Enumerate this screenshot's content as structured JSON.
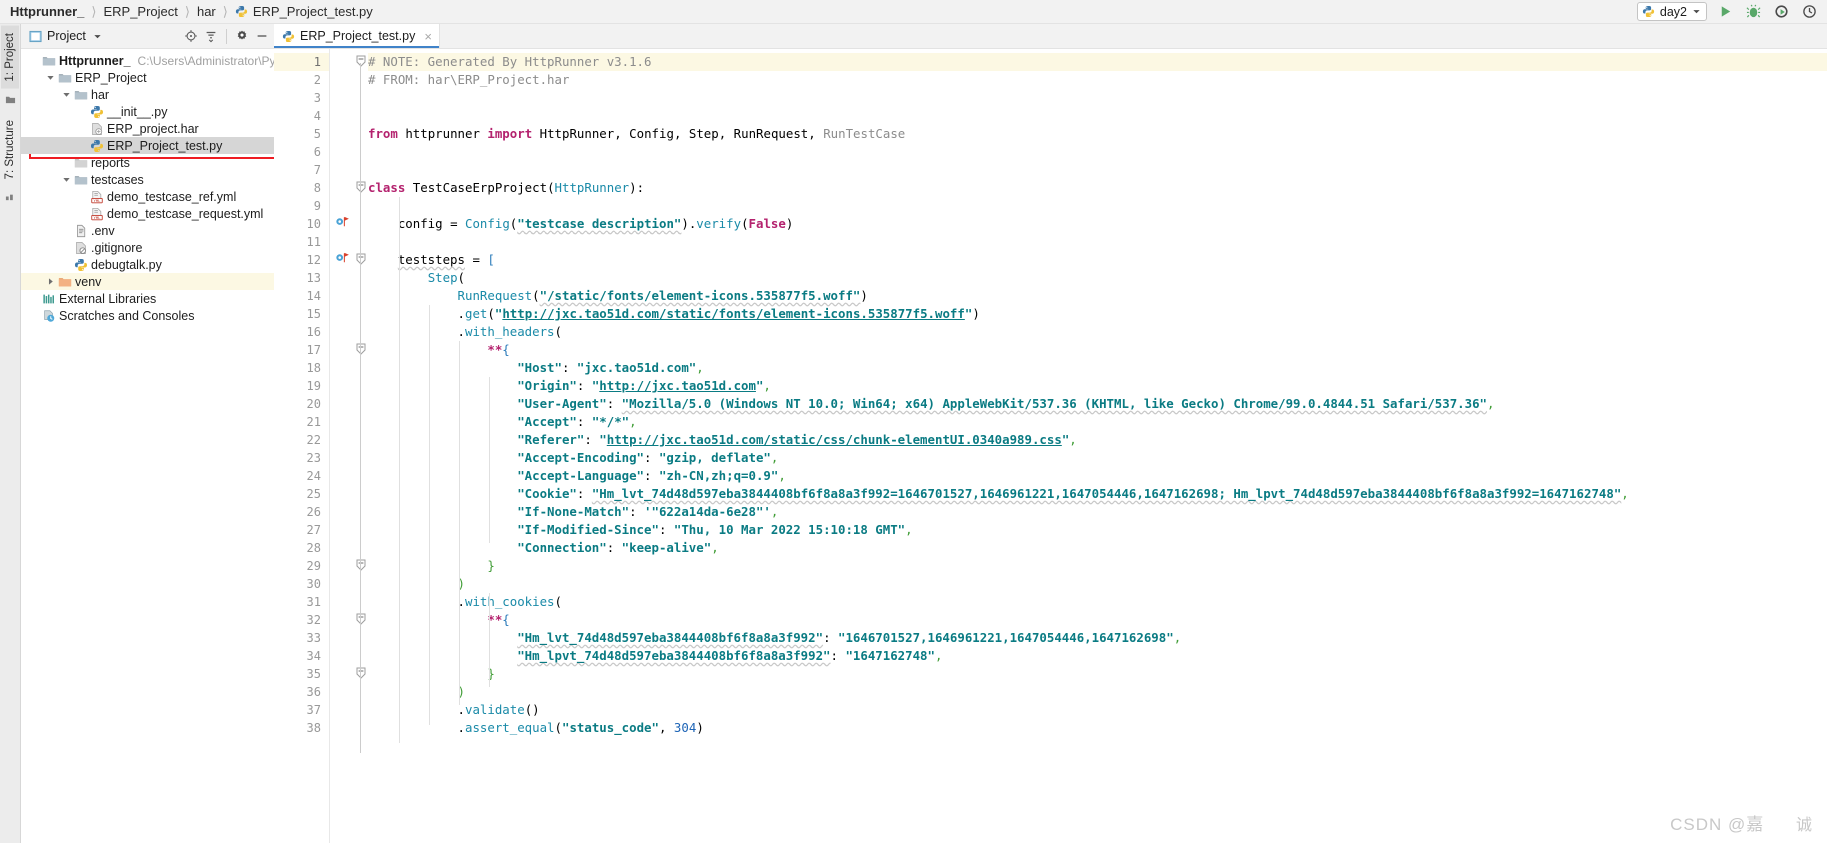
{
  "window": {
    "breadcrumbs": [
      "Httprunner_",
      "ERP_Project",
      "har",
      "ERP_Project_test.py"
    ],
    "run_config": "day2",
    "toolbar_icons": [
      "run-icon",
      "debug-icon",
      "run-coverage-icon",
      "profile-icon"
    ]
  },
  "left_strip": {
    "tabs": [
      "1: Project",
      "7: Structure"
    ],
    "icons": [
      "favorites-icon",
      "todo-icon"
    ]
  },
  "project_panel": {
    "title": "Project",
    "header_icons": [
      "locate-icon",
      "collapse-all-icon",
      "settings-icon",
      "hide-icon"
    ],
    "tree": [
      {
        "label": "Httprunner_",
        "path": "C:\\Users\\Administrator\\Pycharm",
        "icon": "folder-icon",
        "indent": 0,
        "arrow": "none",
        "bold": true,
        "state": "normal"
      },
      {
        "label": "ERP_Project",
        "path": "",
        "icon": "folder-icon",
        "indent": 1,
        "arrow": "down",
        "bold": false,
        "state": "normal"
      },
      {
        "label": "har",
        "path": "",
        "icon": "folder-icon",
        "indent": 2,
        "arrow": "down",
        "bold": false,
        "state": "normal"
      },
      {
        "label": "__init__.py",
        "path": "",
        "icon": "python-file-icon",
        "indent": 3,
        "arrow": "none",
        "bold": false,
        "state": "normal"
      },
      {
        "label": "ERP_project.har",
        "path": "",
        "icon": "har-file-icon",
        "indent": 3,
        "arrow": "none",
        "bold": false,
        "state": "normal"
      },
      {
        "label": "ERP_Project_test.py",
        "path": "",
        "icon": "python-file-icon",
        "indent": 3,
        "arrow": "none",
        "bold": false,
        "state": "selected"
      },
      {
        "label": "reports",
        "path": "",
        "icon": "folder-gray-icon",
        "indent": 2,
        "arrow": "none",
        "bold": false,
        "state": "normal"
      },
      {
        "label": "testcases",
        "path": "",
        "icon": "folder-icon",
        "indent": 2,
        "arrow": "down",
        "bold": false,
        "state": "normal"
      },
      {
        "label": "demo_testcase_ref.yml",
        "path": "",
        "icon": "yml-file-icon",
        "indent": 3,
        "arrow": "none",
        "bold": false,
        "state": "normal"
      },
      {
        "label": "demo_testcase_request.yml",
        "path": "",
        "icon": "yml-file-icon",
        "indent": 3,
        "arrow": "none",
        "bold": false,
        "state": "normal"
      },
      {
        "label": ".env",
        "path": "",
        "icon": "text-file-icon",
        "indent": 2,
        "arrow": "none",
        "bold": false,
        "state": "normal"
      },
      {
        "label": ".gitignore",
        "path": "",
        "icon": "gitignore-file-icon",
        "indent": 2,
        "arrow": "none",
        "bold": false,
        "state": "normal"
      },
      {
        "label": "debugtalk.py",
        "path": "",
        "icon": "python-file-icon",
        "indent": 2,
        "arrow": "none",
        "bold": false,
        "state": "normal"
      },
      {
        "label": "venv",
        "path": "",
        "icon": "folder-orange-icon",
        "indent": 1,
        "arrow": "right",
        "bold": false,
        "state": "highlight"
      },
      {
        "label": "External Libraries",
        "path": "",
        "icon": "libraries-icon",
        "indent": 0,
        "arrow": "none",
        "bold": false,
        "state": "normal"
      },
      {
        "label": "Scratches and Consoles",
        "path": "",
        "icon": "scratches-icon",
        "indent": 0,
        "arrow": "none",
        "bold": false,
        "state": "normal"
      }
    ]
  },
  "editor": {
    "tab": {
      "label": "ERP_Project_test.py",
      "icon": "python-file-icon",
      "close": "×"
    },
    "current_line": 1,
    "breakpoint_lines": [
      10,
      12
    ],
    "lines": [
      {
        "n": 1,
        "fold": "end",
        "html": "<span class=\"t-com\"># NOTE: Generated By HttpRunner v3.1.6</span>"
      },
      {
        "n": 2,
        "fold": "none",
        "html": "<span class=\"t-com\"># FROM: har\\ERP_Project.har</span>"
      },
      {
        "n": 3,
        "fold": "none",
        "html": ""
      },
      {
        "n": 4,
        "fold": "none",
        "html": ""
      },
      {
        "n": 5,
        "fold": "none",
        "html": "<span class=\"t-kw\">from</span> <span class=\"t-id\">httprunner</span> <span class=\"t-kw\">import</span> <span class=\"t-id\">HttpRunner</span><span class=\"t-punc\">,</span> <span class=\"t-id\">Config</span><span class=\"t-punc\">,</span> <span class=\"t-id\">Step</span><span class=\"t-punc\">,</span> <span class=\"t-id\">RunRequest</span><span class=\"t-punc\">,</span> <span class=\"t-gray\">RunTestCase</span>"
      },
      {
        "n": 6,
        "fold": "none",
        "html": ""
      },
      {
        "n": 7,
        "fold": "none",
        "html": ""
      },
      {
        "n": 8,
        "fold": "start",
        "html": "<span class=\"t-kw\">class</span> <span class=\"t-cls\">TestCaseErpProject</span><span class=\"t-punc\">(</span><span class=\"t-fn\">HttpRunner</span><span class=\"t-punc\">):</span>"
      },
      {
        "n": 9,
        "fold": "none",
        "html": ""
      },
      {
        "n": 10,
        "fold": "none",
        "html": "    <span class=\"t-id\">config</span> <span class=\"t-punc\">=</span> <span class=\"t-fn\">Config</span><span class=\"t-punc\">(</span><span class=\"t-strb squig\">\"testcase description\"</span><span class=\"t-punc\">).</span><span class=\"t-fn\">verify</span><span class=\"t-punc\">(</span><span class=\"t-kw\">False</span><span class=\"t-punc\">)</span>"
      },
      {
        "n": 11,
        "fold": "none",
        "html": ""
      },
      {
        "n": 12,
        "fold": "start",
        "html": "    <span class=\"t-id squig\">teststeps</span> <span class=\"t-punc\">=</span> <span class=\"t-blue\">[</span>"
      },
      {
        "n": 13,
        "fold": "none",
        "html": "        <span class=\"t-fn\">Step</span><span class=\"t-punc\">(</span>"
      },
      {
        "n": 14,
        "fold": "none",
        "html": "            <span class=\"t-fn\">RunRequest</span><span class=\"t-punc\">(</span><span class=\"t-strb squig\">\"/static/fonts/element-icons.535877f5.woff\"</span><span class=\"t-punc\">)</span>"
      },
      {
        "n": 15,
        "fold": "none",
        "html": "            <span class=\"t-punc\">.</span><span class=\"t-fn\">get</span><span class=\"t-punc\">(</span><span class=\"t-strb\">\"</span><span class=\"t-url\">http://jxc.tao51d.com/static/fonts/element-icons.535877f5.woff</span><span class=\"t-strb\">\"</span><span class=\"t-punc\">)</span>"
      },
      {
        "n": 16,
        "fold": "none",
        "html": "            <span class=\"t-punc\">.</span><span class=\"t-fn\">with_headers</span><span class=\"t-punc\">(</span>"
      },
      {
        "n": 17,
        "fold": "start",
        "html": "                <span class=\"t-kw\">**</span><span class=\"t-blue\">{</span>"
      },
      {
        "n": 18,
        "fold": "none",
        "html": "                    <span class=\"t-strb\">\"Host\"</span><span class=\"t-punc\">:</span> <span class=\"t-strb\">\"jxc.tao51d.com\"</span><span class=\"t-green\">,</span>"
      },
      {
        "n": 19,
        "fold": "none",
        "html": "                    <span class=\"t-strb\">\"Origin\"</span><span class=\"t-punc\">:</span> <span class=\"t-strb\">\"</span><span class=\"t-url\">http://jxc.tao51d.com</span><span class=\"t-strb\">\"</span><span class=\"t-green\">,</span>"
      },
      {
        "n": 20,
        "fold": "none",
        "html": "                    <span class=\"t-strb\">\"User-Agent\"</span><span class=\"t-punc\">:</span> <span class=\"t-strb squig\">\"Mozilla/5.0 (Windows NT 10.0; Win64; x64) AppleWebKit/537.36 (KHTML, like Gecko) Chrome/99.0.4844.51 Safari/537.36\"</span><span class=\"t-green\">,</span>"
      },
      {
        "n": 21,
        "fold": "none",
        "html": "                    <span class=\"t-strb\">\"Accept\"</span><span class=\"t-punc\">:</span> <span class=\"t-strb\">\"*/*\"</span><span class=\"t-green\">,</span>"
      },
      {
        "n": 22,
        "fold": "none",
        "html": "                    <span class=\"t-strb\">\"Referer\"</span><span class=\"t-punc\">:</span> <span class=\"t-strb\">\"</span><span class=\"t-url\">http://jxc.tao51d.com/static/css/chunk-elementUI.0340a989.css</span><span class=\"t-strb\">\"</span><span class=\"t-green\">,</span>"
      },
      {
        "n": 23,
        "fold": "none",
        "html": "                    <span class=\"t-strb\">\"Accept-Encoding\"</span><span class=\"t-punc\">:</span> <span class=\"t-strb\">\"gzip, deflate\"</span><span class=\"t-green\">,</span>"
      },
      {
        "n": 24,
        "fold": "none",
        "html": "                    <span class=\"t-strb\">\"Accept-Language\"</span><span class=\"t-punc\">:</span> <span class=\"t-strb\">\"zh-CN,zh;q=0.9\"</span><span class=\"t-green\">,</span>"
      },
      {
        "n": 25,
        "fold": "none",
        "html": "                    <span class=\"t-strb\">\"Cookie\"</span><span class=\"t-punc\">:</span> <span class=\"t-strb squig\">\"Hm_lvt_74d48d597eba3844408bf6f8a8a3f992=1646701527,1646961221,1647054446,1647162698; Hm_lpvt_74d48d597eba3844408bf6f8a8a3f992=1647162748\"</span><span class=\"t-green\">,</span>"
      },
      {
        "n": 26,
        "fold": "none",
        "html": "                    <span class=\"t-strb\">\"If-None-Match\"</span><span class=\"t-punc\">:</span> <span class=\"t-strb\">'\"622a14da-6e28\"'</span><span class=\"t-green\">,</span>"
      },
      {
        "n": 27,
        "fold": "none",
        "html": "                    <span class=\"t-strb\">\"If-Modified-Since\"</span><span class=\"t-punc\">:</span> <span class=\"t-strb\">\"Thu, 10 Mar 2022 15:10:18 GMT\"</span><span class=\"t-green\">,</span>"
      },
      {
        "n": 28,
        "fold": "none",
        "html": "                    <span class=\"t-strb\">\"Connection\"</span><span class=\"t-punc\">:</span> <span class=\"t-strb\">\"keep-alive\"</span><span class=\"t-green\">,</span>"
      },
      {
        "n": 29,
        "fold": "end",
        "html": "                <span class=\"t-green\">}</span>"
      },
      {
        "n": 30,
        "fold": "none",
        "html": "            <span class=\"t-green\">)</span>"
      },
      {
        "n": 31,
        "fold": "none",
        "html": "            <span class=\"t-punc\">.</span><span class=\"t-fn\">with_cookies</span><span class=\"t-punc\">(</span>"
      },
      {
        "n": 32,
        "fold": "start",
        "html": "                <span class=\"t-kw\">**</span><span class=\"t-blue\">{</span>"
      },
      {
        "n": 33,
        "fold": "none",
        "html": "                    <span class=\"t-strb squig\">\"Hm_lvt_74d48d597eba3844408bf6f8a8a3f992\"</span><span class=\"t-punc\">:</span> <span class=\"t-strb\">\"1646701527,1646961221,1647054446,1647162698\"</span><span class=\"t-green\">,</span>"
      },
      {
        "n": 34,
        "fold": "none",
        "html": "                    <span class=\"t-strb squig\">\"Hm_lpvt_74d48d597eba3844408bf6f8a8a3f992\"</span><span class=\"t-punc\">:</span> <span class=\"t-strb\">\"1647162748\"</span><span class=\"t-green\">,</span>"
      },
      {
        "n": 35,
        "fold": "end",
        "html": "                <span class=\"t-green\">}</span>"
      },
      {
        "n": 36,
        "fold": "none",
        "html": "            <span class=\"t-green\">)</span>"
      },
      {
        "n": 37,
        "fold": "none",
        "html": "            <span class=\"t-punc\">.</span><span class=\"t-fn\">validate</span><span class=\"t-punc\">()</span>"
      },
      {
        "n": 38,
        "fold": "none",
        "html": "            <span class=\"t-punc\">.</span><span class=\"t-fn\">assert_equal</span><span class=\"t-punc\">(</span><span class=\"t-strb\">\"status_code\"</span><span class=\"t-punc\">,</span> <span class=\"t-num\">304</span><span class=\"t-punc\">)</span>"
      }
    ]
  },
  "watermark": {
    "text": "CSDN @嘉",
    "suffix": "诚"
  },
  "colors": {
    "accent": "#4083c9",
    "selection": "#d6d6d6",
    "current_line": "#fcf8e3",
    "red_highlight": "#ee1c22",
    "string": "#0a7b83",
    "keyword": "#b4226e",
    "comment": "#8c8c8c"
  }
}
